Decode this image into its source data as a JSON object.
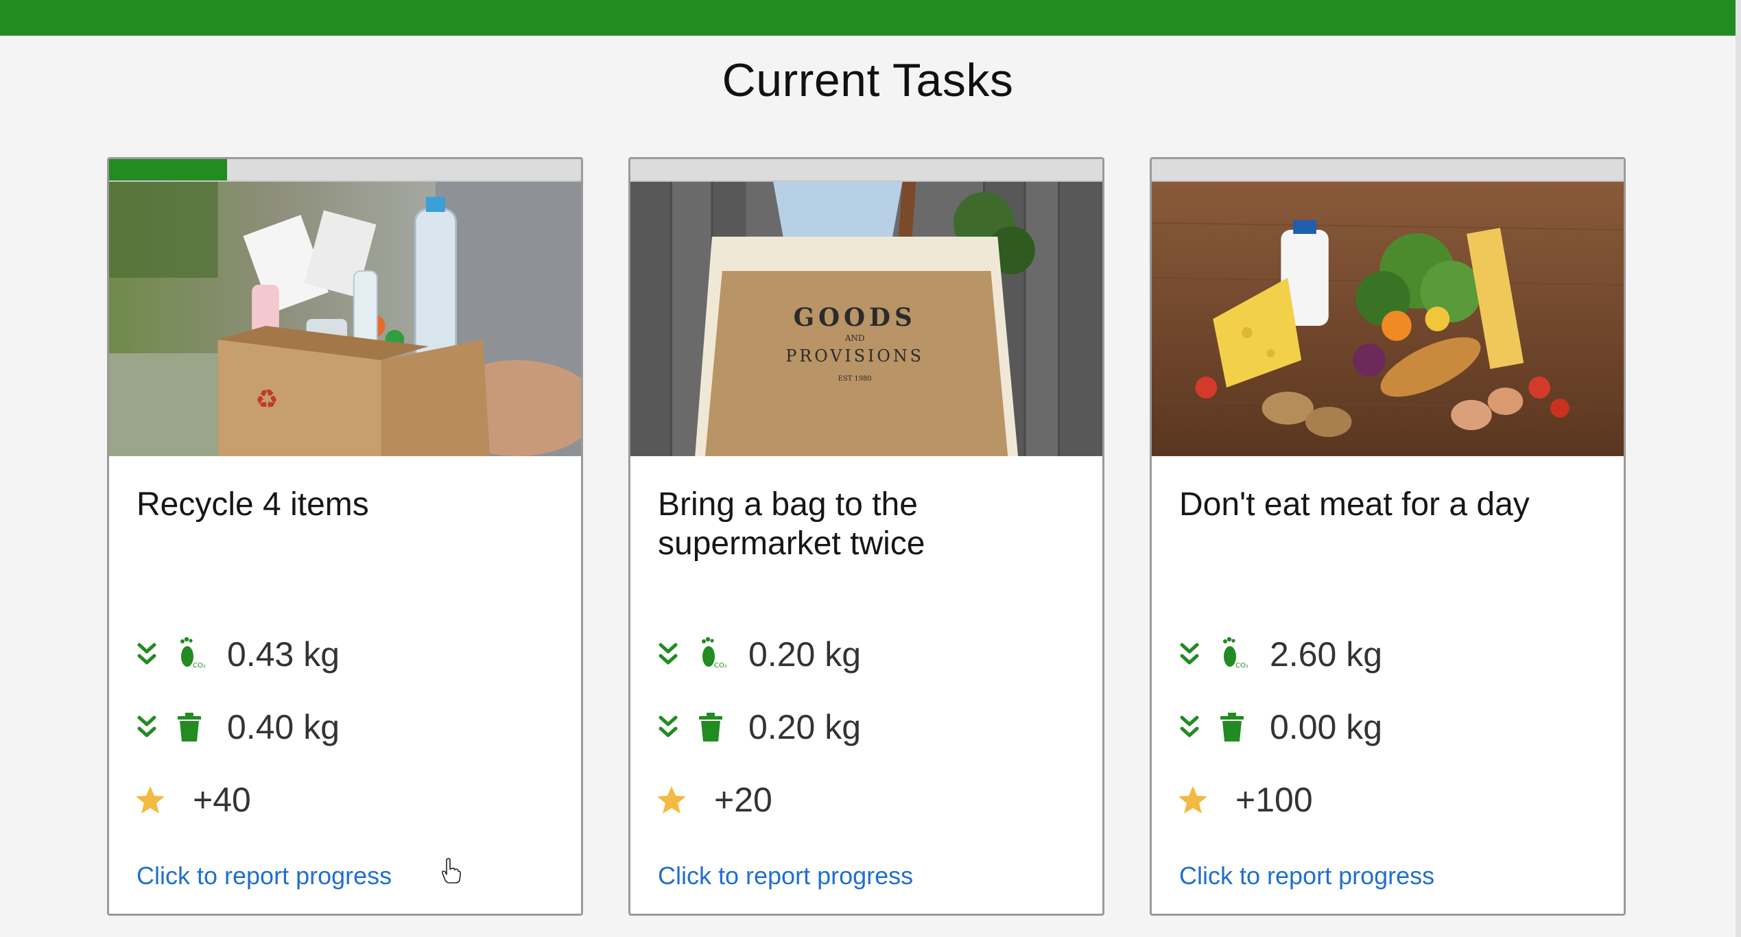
{
  "page": {
    "title": "Current Tasks",
    "accent_color": "#228b22",
    "link_color": "#1f6fd0",
    "star_color": "#f4b942"
  },
  "cards": [
    {
      "title": "Recycle 4 items",
      "progress_percent": 25,
      "co2_saving": "0.43 kg",
      "waste_saving": "0.40 kg",
      "points": "+40",
      "link": "Click to report progress",
      "image_label": "cardboard-box-with-plastic-bottles"
    },
    {
      "title": "Bring a bag to the supermarket twice",
      "progress_percent": 0,
      "co2_saving": "0.20 kg",
      "waste_saving": "0.20 kg",
      "points": "+20",
      "link": "Click to report progress",
      "image_label": "jute-shopping-bag",
      "image_text": {
        "line1": "GOODS",
        "line2": "AND",
        "line3": "PROVISIONS",
        "line4": "EST 1980"
      }
    },
    {
      "title": "Don't eat meat for a day",
      "progress_percent": 0,
      "co2_saving": "2.60 kg",
      "waste_saving": "0.00 kg",
      "points": "+100",
      "link": "Click to report progress",
      "image_label": "vegetables-cheese-bread-on-table"
    }
  ],
  "icons": {
    "reduction": "double-chevron-down-icon",
    "co2": "co2-footprint-icon",
    "waste": "trash-icon",
    "points": "star-icon"
  }
}
